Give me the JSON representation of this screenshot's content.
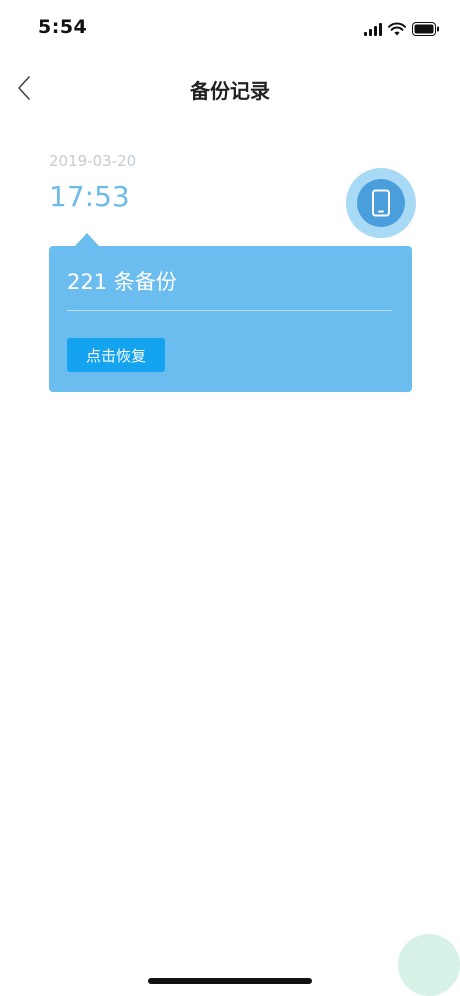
{
  "status_bar": {
    "time": "5:54",
    "icons": [
      "signal-icon",
      "wifi-icon",
      "battery-icon"
    ]
  },
  "nav": {
    "title": "备份记录",
    "back_icon": "chevron-left-icon"
  },
  "record": {
    "date": "2019-03-20",
    "time": "17:53",
    "device_icon": "phone-icon",
    "count_label": "221 条备份",
    "restore_label": "点击恢复"
  },
  "colors": {
    "accent": "#6bbdf0",
    "button": "#14a3ee",
    "time_text": "#6cbbe8",
    "date_text": "#c3cbd3",
    "badge_outer": "#a9daf5",
    "badge_inner": "#4a9edc"
  }
}
